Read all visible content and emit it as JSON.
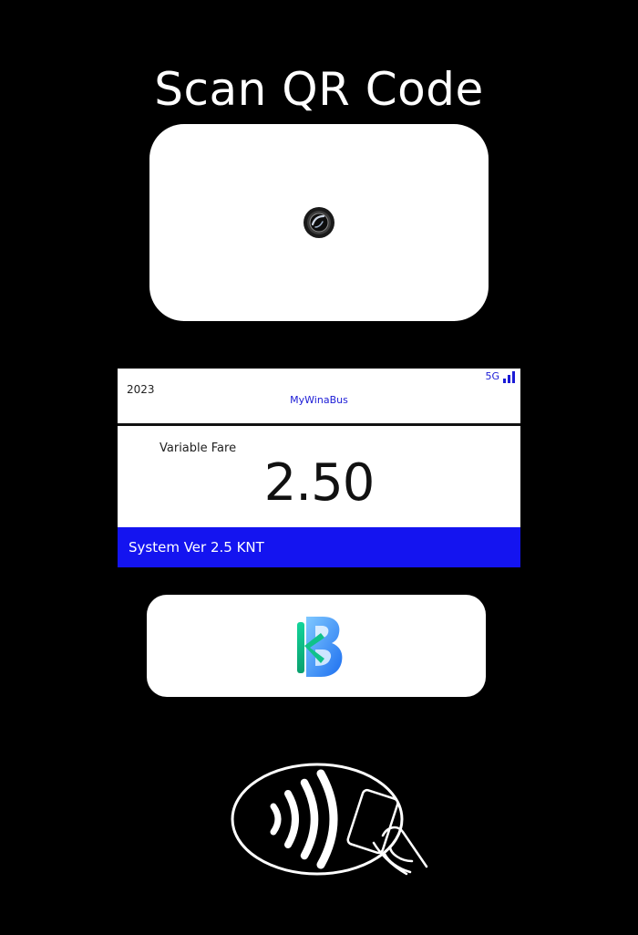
{
  "title": "Scan QR Code",
  "scanner": {
    "icon": "camera-lens-icon"
  },
  "screen": {
    "year": "2023",
    "app_name": "MyWinaBus",
    "network": "5G",
    "signal_icon": "signal-bars-icon",
    "fare_label": "Variable Fare",
    "fare_amount": "2.50",
    "status_text": "System Ver 2.5 KNT"
  },
  "logo": {
    "icon": "brand-b-logo"
  },
  "contactless": {
    "icon": "contactless-card-tap-icon"
  },
  "colors": {
    "background": "#000000",
    "panel": "#ffffff",
    "accent_blue": "#1414f0",
    "app_text_blue": "#1b1bd6"
  }
}
